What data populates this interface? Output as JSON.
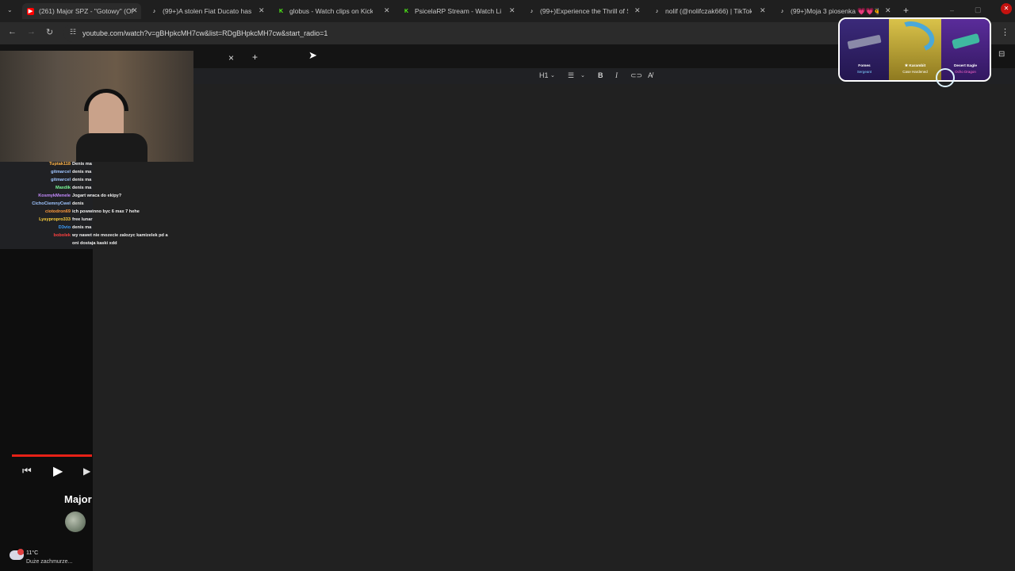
{
  "browser": {
    "tabs": [
      {
        "title": "(261) Major SPZ - \"Gotowy\" (Of",
        "icon": "youtube-icon",
        "color": "#ff0000"
      },
      {
        "title": "(99+)A stolen Fiat Ducato has c",
        "icon": "tiktok-icon",
        "color": "#ffffff"
      },
      {
        "title": "globus - Watch clips on Kick",
        "icon": "kick-icon",
        "color": "#53fc18"
      },
      {
        "title": "PsicelaRP Stream - Watch Live",
        "icon": "kick-icon",
        "color": "#53fc18"
      },
      {
        "title": "(99+)Experience the Thrill of Sp",
        "icon": "tiktok-icon",
        "color": "#ffffff"
      },
      {
        "title": "nolif (@nolifczak666) | TikTok",
        "icon": "tiktok-icon",
        "color": "#ffffff"
      },
      {
        "title": "(99+)Moja 3 piosenka 💗💗🐝",
        "icon": "tiktok-icon",
        "color": "#ffffff"
      }
    ],
    "new_tab_label": "+",
    "url": "youtube.com/watch?v=gBHpkcMH7cw&list=RDgBHpkcMH7cw&start_radio=1"
  },
  "editor_toolbar": {
    "heading": "H1",
    "bold": "B",
    "italic": "I",
    "close": "×",
    "add": "+"
  },
  "chat": [
    {
      "user": "Tuptak118",
      "text": "Denis ma",
      "color": "#ffb347"
    },
    {
      "user": "gitmarcel",
      "text": "denis ma",
      "color": "#9fc5ff"
    },
    {
      "user": "gitmarcel",
      "text": "denis ma",
      "color": "#9fc5ff"
    },
    {
      "user": "Maxdik",
      "text": "denis ma",
      "color": "#7cfc9a"
    },
    {
      "user": "KosmykMenele",
      "text": "Jogart wraca do ekipy?",
      "color": "#c58bff"
    },
    {
      "user": "CichoCiemnyCwel",
      "text": "denis",
      "color": "#9fc5ff"
    },
    {
      "user": "ciotodron69",
      "text": "ich powwinno byc 6 max 7 hehe",
      "color": "#ff9a3c"
    },
    {
      "user": "Lysypropro333",
      "text": "free lunar",
      "color": "#ffd23c"
    },
    {
      "user": "D3vio",
      "text": "denis ma",
      "color": "#3ca0ff"
    },
    {
      "user": "bobolek",
      "text": "wy nawet nie mozecie zalozyc kamizelek pd a",
      "color": "#ff4040"
    },
    {
      "user": "",
      "text": "oni dostaja kaski xdd",
      "color": "#ffffff"
    }
  ],
  "video": {
    "title": "Major",
    "progress": 1.0
  },
  "skins": [
    {
      "name": "Fomes",
      "sub": "Sergeant"
    },
    {
      "name": "★ Karambit",
      "sub": "Case Hardened"
    },
    {
      "name": "Desert Eagle",
      "sub": "Ocho Dragon"
    }
  ],
  "weather": {
    "temp": "11°C",
    "desc": "Duże zachmurze..."
  }
}
